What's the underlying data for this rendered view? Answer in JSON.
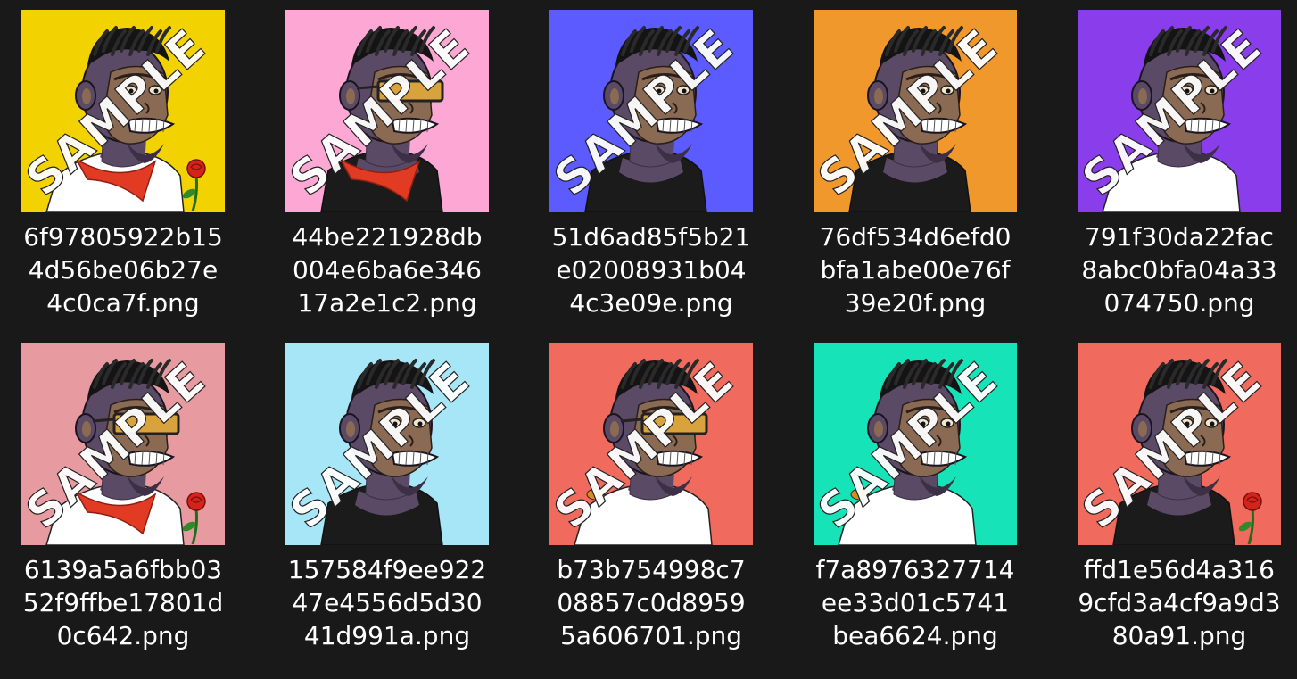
{
  "watermark_text": "SAMPLE",
  "files": [
    {
      "name": "6f97805922b154d56be06b27e4c0ca7f.png",
      "lines": [
        "6f97805922b15",
        "4d56be06b27e",
        "4c0ca7f.png"
      ],
      "bg": "#f2d200",
      "clothing": "white-shirt",
      "bandana": true,
      "glasses": false,
      "rose": true,
      "bird": false,
      "cigarette": false
    },
    {
      "name": "44be221928db004e6ba6e34617a2e1c2.png",
      "lines": [
        "44be221928db",
        "004e6ba6e346",
        "17a2e1c2.png"
      ],
      "bg": "#fda7d5",
      "clothing": "black-tank",
      "bandana": true,
      "glasses": true,
      "rose": false,
      "bird": false,
      "cigarette": false
    },
    {
      "name": "51d6ad85f5b21e02008931b044c3e09e.png",
      "lines": [
        "51d6ad85f5b21",
        "e02008931b04",
        "4c3e09e.png"
      ],
      "bg": "#5b5bff",
      "clothing": "black-tank",
      "bandana": false,
      "glasses": false,
      "rose": false,
      "bird": false,
      "cigarette": false
    },
    {
      "name": "76df534d6efd0bfa1abe00e76f39e20f.png",
      "lines": [
        "76df534d6efd0",
        "bfa1abe00e76f",
        "39e20f.png"
      ],
      "bg": "#f0982c",
      "clothing": "black-tank",
      "bandana": false,
      "glasses": false,
      "rose": false,
      "bird": false,
      "cigarette": false
    },
    {
      "name": "791f30da22fac8abc0bfa04a33074750.png",
      "lines": [
        "791f30da22fac",
        "8abc0bfa04a33",
        "074750.png"
      ],
      "bg": "#8a3dea",
      "clothing": "white-shirt",
      "bandana": false,
      "glasses": false,
      "rose": false,
      "bird": false,
      "cigarette": false
    },
    {
      "name": "6139a5a6fbb0352f9ffbe17801d0c642.png",
      "lines": [
        "6139a5a6fbb03",
        "52f9ffbe17801d",
        "0c642.png"
      ],
      "bg": "#e79ba1",
      "clothing": "white-shirt",
      "bandana": true,
      "glasses": true,
      "rose": true,
      "bird": false,
      "cigarette": false
    },
    {
      "name": "157584f9ee92247e4556d5d3041d991a.png",
      "lines": [
        "157584f9ee922",
        "47e4556d5d30",
        "41d991a.png"
      ],
      "bg": "#a6e6f6",
      "clothing": "black-tank",
      "bandana": false,
      "glasses": false,
      "rose": false,
      "bird": false,
      "cigarette": false
    },
    {
      "name": "b73b754998c708857c0d89595a606701.png",
      "lines": [
        "b73b754998c7",
        "08857c0d8959",
        "5a606701.png"
      ],
      "bg": "#f06a5e",
      "clothing": "white-shirt",
      "bandana": false,
      "glasses": true,
      "rose": false,
      "bird": true,
      "cigarette": false
    },
    {
      "name": "f7a8976327714ee33d01c5741bea6624.png",
      "lines": [
        "f7a8976327714",
        "ee33d01c5741",
        "bea6624.png"
      ],
      "bg": "#16e3b8",
      "clothing": "white-shirt",
      "bandana": false,
      "glasses": false,
      "rose": false,
      "bird": true,
      "cigarette": false
    },
    {
      "name": "ffd1e56d4a3169cfd3a4cf9a9d380a91.png",
      "lines": [
        "ffd1e56d4a316",
        "9cfd3a4cf9a9d3",
        "80a91.png"
      ],
      "bg": "#f06a5e",
      "clothing": "black-tank",
      "bandana": false,
      "glasses": false,
      "rose": true,
      "bird": false,
      "cigarette": false
    }
  ]
}
